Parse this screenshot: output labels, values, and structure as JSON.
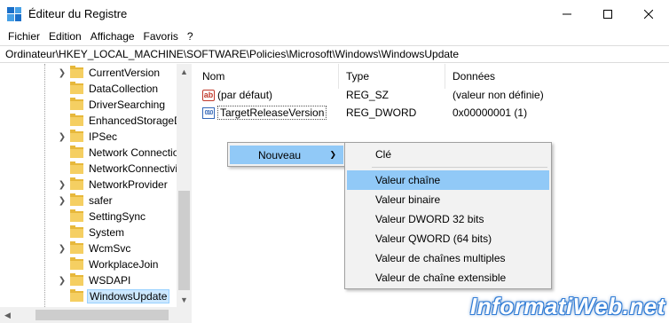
{
  "window": {
    "title": "Éditeur du Registre"
  },
  "menu": [
    "Fichier",
    "Edition",
    "Affichage",
    "Favoris",
    "?"
  ],
  "address": "Ordinateur\\HKEY_LOCAL_MACHINE\\SOFTWARE\\Policies\\Microsoft\\Windows\\WindowsUpdate",
  "tree": {
    "items": [
      {
        "label": "CurrentVersion",
        "expandable": true
      },
      {
        "label": "DataCollection",
        "expandable": false
      },
      {
        "label": "DriverSearching",
        "expandable": false
      },
      {
        "label": "EnhancedStorageDe",
        "expandable": false
      },
      {
        "label": "IPSec",
        "expandable": true
      },
      {
        "label": "Network Connectio",
        "expandable": false
      },
      {
        "label": "NetworkConnectivi",
        "expandable": false
      },
      {
        "label": "NetworkProvider",
        "expandable": true
      },
      {
        "label": "safer",
        "expandable": true
      },
      {
        "label": "SettingSync",
        "expandable": false
      },
      {
        "label": "System",
        "expandable": false
      },
      {
        "label": "WcmSvc",
        "expandable": true
      },
      {
        "label": "WorkplaceJoin",
        "expandable": false
      },
      {
        "label": "WSDAPI",
        "expandable": true
      },
      {
        "label": "WindowsUpdate",
        "expandable": false,
        "selected": true
      }
    ]
  },
  "values": {
    "headers": {
      "name": "Nom",
      "type": "Type",
      "data": "Données"
    },
    "rows": [
      {
        "icon": "ab",
        "name": "(par défaut)",
        "type": "REG_SZ",
        "data": "(valeur non définie)"
      },
      {
        "icon": "010",
        "name": "TargetReleaseVersion",
        "type": "REG_DWORD",
        "data": "0x00000001 (1)"
      }
    ]
  },
  "context_menu": {
    "parent_label": "Nouveau",
    "items": [
      "Clé",
      "Valeur chaîne",
      "Valeur binaire",
      "Valeur DWORD 32 bits",
      "Valeur QWORD (64 bits)",
      "Valeur de chaînes multiples",
      "Valeur de chaîne extensible"
    ],
    "highlighted": "Valeur chaîne"
  },
  "watermark": "InformatiWeb.net",
  "colors": {
    "highlight": "#91c9f7",
    "selection": "#cce8ff",
    "folder": "#f5cf62",
    "accent": "#1a6fc9"
  }
}
